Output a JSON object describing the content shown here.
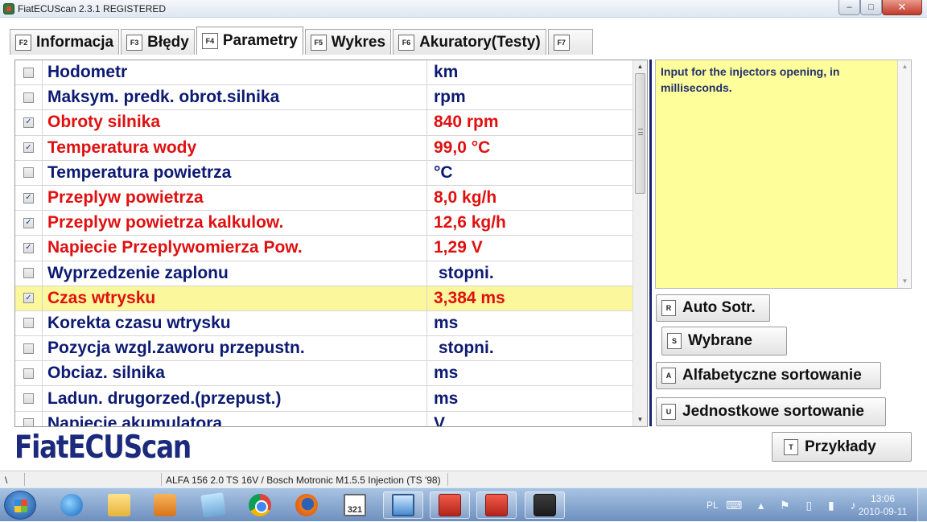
{
  "window": {
    "title": "FiatECUScan 2.3.1 REGISTERED",
    "minimize": "–",
    "maximize": "□",
    "close": "✕"
  },
  "tabs": [
    {
      "key": "F2",
      "label": "Informacja",
      "active": false
    },
    {
      "key": "F3",
      "label": "Błędy",
      "active": false
    },
    {
      "key": "F4",
      "label": "Parametry",
      "active": true
    },
    {
      "key": "F5",
      "label": "Wykres",
      "active": false
    },
    {
      "key": "F6",
      "label": "Akuratory(Testy)",
      "active": false
    },
    {
      "key": "F7",
      "label": "",
      "active": false
    }
  ],
  "parameters": [
    {
      "name": "Hodometr",
      "value": "km",
      "checked": false,
      "selected": false
    },
    {
      "name": "Maksym. predk. obrot.silnika",
      "value": "rpm",
      "checked": false,
      "selected": false
    },
    {
      "name": "Obroty silnika",
      "value": "840 rpm",
      "checked": true,
      "selected": false
    },
    {
      "name": "Temperatura wody",
      "value": "99,0 °C",
      "checked": true,
      "selected": false
    },
    {
      "name": "Temperatura powietrza",
      "value": "°C",
      "checked": false,
      "selected": false
    },
    {
      "name": "Przeplyw powietrza",
      "value": "8,0 kg/h",
      "checked": true,
      "selected": false
    },
    {
      "name": "Przeplyw powietrza kalkulow.",
      "value": "12,6 kg/h",
      "checked": true,
      "selected": false
    },
    {
      "name": "Napiecie Przeplywomierza Pow.",
      "value": "1,29 V",
      "checked": true,
      "selected": false
    },
    {
      "name": "Wyprzedzenie zaplonu",
      "value": " stopni.",
      "checked": false,
      "selected": false
    },
    {
      "name": "Czas wtrysku",
      "value": "3,384 ms",
      "checked": true,
      "selected": true
    },
    {
      "name": "Korekta czasu wtrysku",
      "value": "ms",
      "checked": false,
      "selected": false
    },
    {
      "name": "Pozycja wzgl.zaworu przepustn.",
      "value": " stopni.",
      "checked": false,
      "selected": false
    },
    {
      "name": "Obciaz. silnika",
      "value": "ms",
      "checked": false,
      "selected": false
    },
    {
      "name": "Ladun. drugorzed.(przepust.)",
      "value": "ms",
      "checked": false,
      "selected": false
    },
    {
      "name": "Napiecie akumulatora",
      "value": "V",
      "checked": false,
      "selected": false
    }
  ],
  "description": {
    "text": "Input for the injectors opening, in milliseconds."
  },
  "buttons": {
    "auto_sort": {
      "key": "R",
      "label": "Auto Sotr."
    },
    "selected": {
      "key": "S",
      "label": "Wybrane"
    },
    "alpha_sort": {
      "key": "A",
      "label": "Alfabetyczne sortowanie"
    },
    "unit_sort": {
      "key": "U",
      "label": "Jednostkowe sortowanie"
    },
    "examples": {
      "key": "T",
      "label": "Przykłady"
    }
  },
  "brand": "FiatECUScan",
  "statusbar": {
    "left": "\\",
    "vehicle": "ALFA 156 2.0 TS 16V / Bosch Motronic M1.5.5 Injection (TS '98)"
  },
  "taskbar": {
    "apps": [
      {
        "name": "internet-explorer-icon"
      },
      {
        "name": "file-explorer-icon"
      },
      {
        "name": "media-player-icon"
      },
      {
        "name": "pictures-icon"
      },
      {
        "name": "chrome-icon"
      },
      {
        "name": "firefox-icon"
      },
      {
        "name": "calendar-icon",
        "text": "321"
      },
      {
        "name": "monitor-icon"
      },
      {
        "name": "toolbox-icon"
      },
      {
        "name": "toolbox-icon"
      },
      {
        "name": "fiat-ecuscan-icon"
      }
    ],
    "language": "PL",
    "time": "13:06",
    "date": "2010-09-11"
  },
  "colors": {
    "active_text": "#e01010",
    "inactive_text": "#0c1a72",
    "selected_row": "#fbf79c",
    "description_bg": "#fefe9a"
  }
}
